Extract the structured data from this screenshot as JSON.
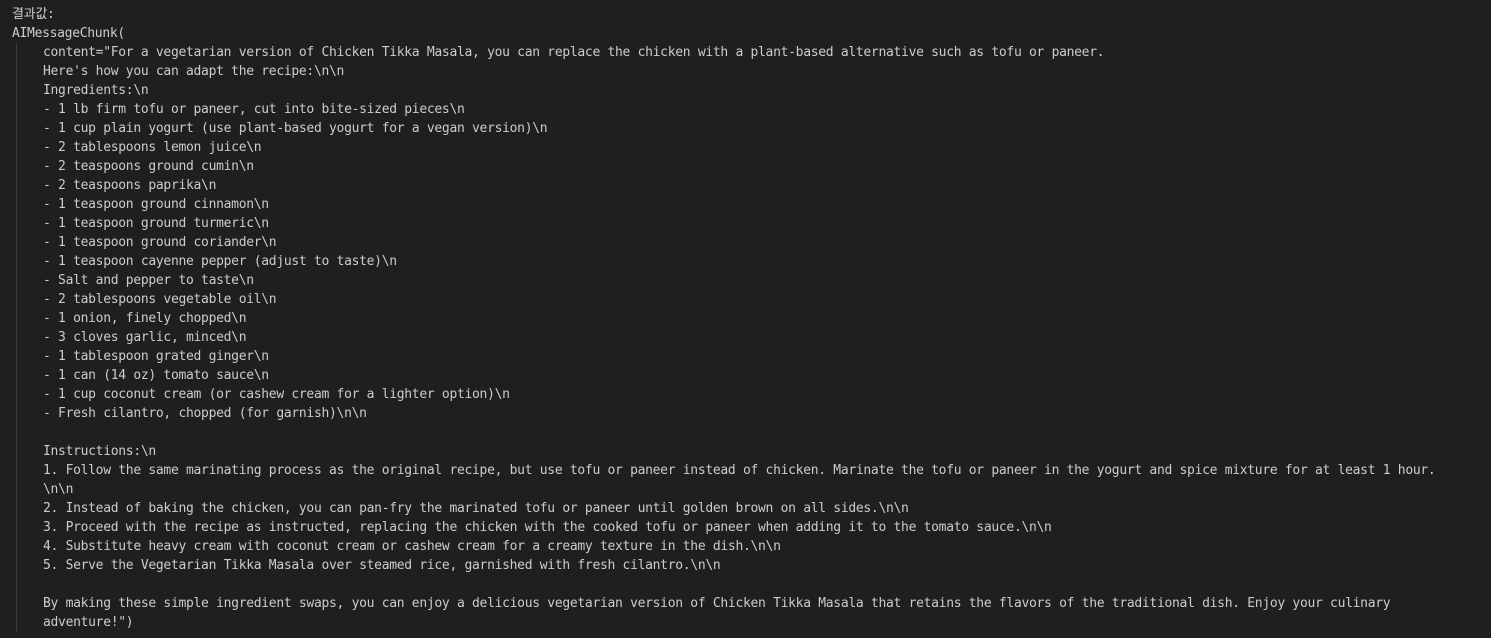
{
  "output": {
    "label": "결과값:",
    "class_open": "AIMessageChunk(",
    "lines": [
      "content=\"For a vegetarian version of Chicken Tikka Masala, you can replace the chicken with a plant-based alternative such as tofu or paneer.",
      "Here's how you can adapt the recipe:\\n\\n",
      "Ingredients:\\n",
      "- 1 lb firm tofu or paneer, cut into bite-sized pieces\\n",
      "- 1 cup plain yogurt (use plant-based yogurt for a vegan version)\\n",
      "- 2 tablespoons lemon juice\\n",
      "- 2 teaspoons ground cumin\\n",
      "- 2 teaspoons paprika\\n",
      "- 1 teaspoon ground cinnamon\\n",
      "- 1 teaspoon ground turmeric\\n",
      "- 1 teaspoon ground coriander\\n",
      "- 1 teaspoon cayenne pepper (adjust to taste)\\n",
      "- Salt and pepper to taste\\n",
      "- 2 tablespoons vegetable oil\\n",
      "- 1 onion, finely chopped\\n",
      "- 3 cloves garlic, minced\\n",
      "- 1 tablespoon grated ginger\\n",
      "- 1 can (14 oz) tomato sauce\\n",
      "- 1 cup coconut cream (or cashew cream for a lighter option)\\n",
      "- Fresh cilantro, chopped (for garnish)\\n\\n",
      "",
      "Instructions:\\n",
      "1. Follow the same marinating process as the original recipe, but use tofu or paneer instead of chicken. Marinate the tofu or paneer in the yogurt and spice mixture for at least 1 hour.",
      "\\n\\n",
      "2. Instead of baking the chicken, you can pan-fry the marinated tofu or paneer until golden brown on all sides.\\n\\n",
      "3. Proceed with the recipe as instructed, replacing the chicken with the cooked tofu or paneer when adding it to the tomato sauce.\\n\\n",
      "4. Substitute heavy cream with coconut cream or cashew cream for a creamy texture in the dish.\\n\\n",
      "5. Serve the Vegetarian Tikka Masala over steamed rice, garnished with fresh cilantro.\\n\\n",
      "",
      "By making these simple ingredient swaps, you can enjoy a delicious vegetarian version of Chicken Tikka Masala that retains the flavors of the traditional dish. Enjoy your culinary",
      "adventure!\")"
    ]
  },
  "colors": {
    "background": "#1f1f1f",
    "text": "#cccccc",
    "indent_guide": "#3c3c3c"
  }
}
